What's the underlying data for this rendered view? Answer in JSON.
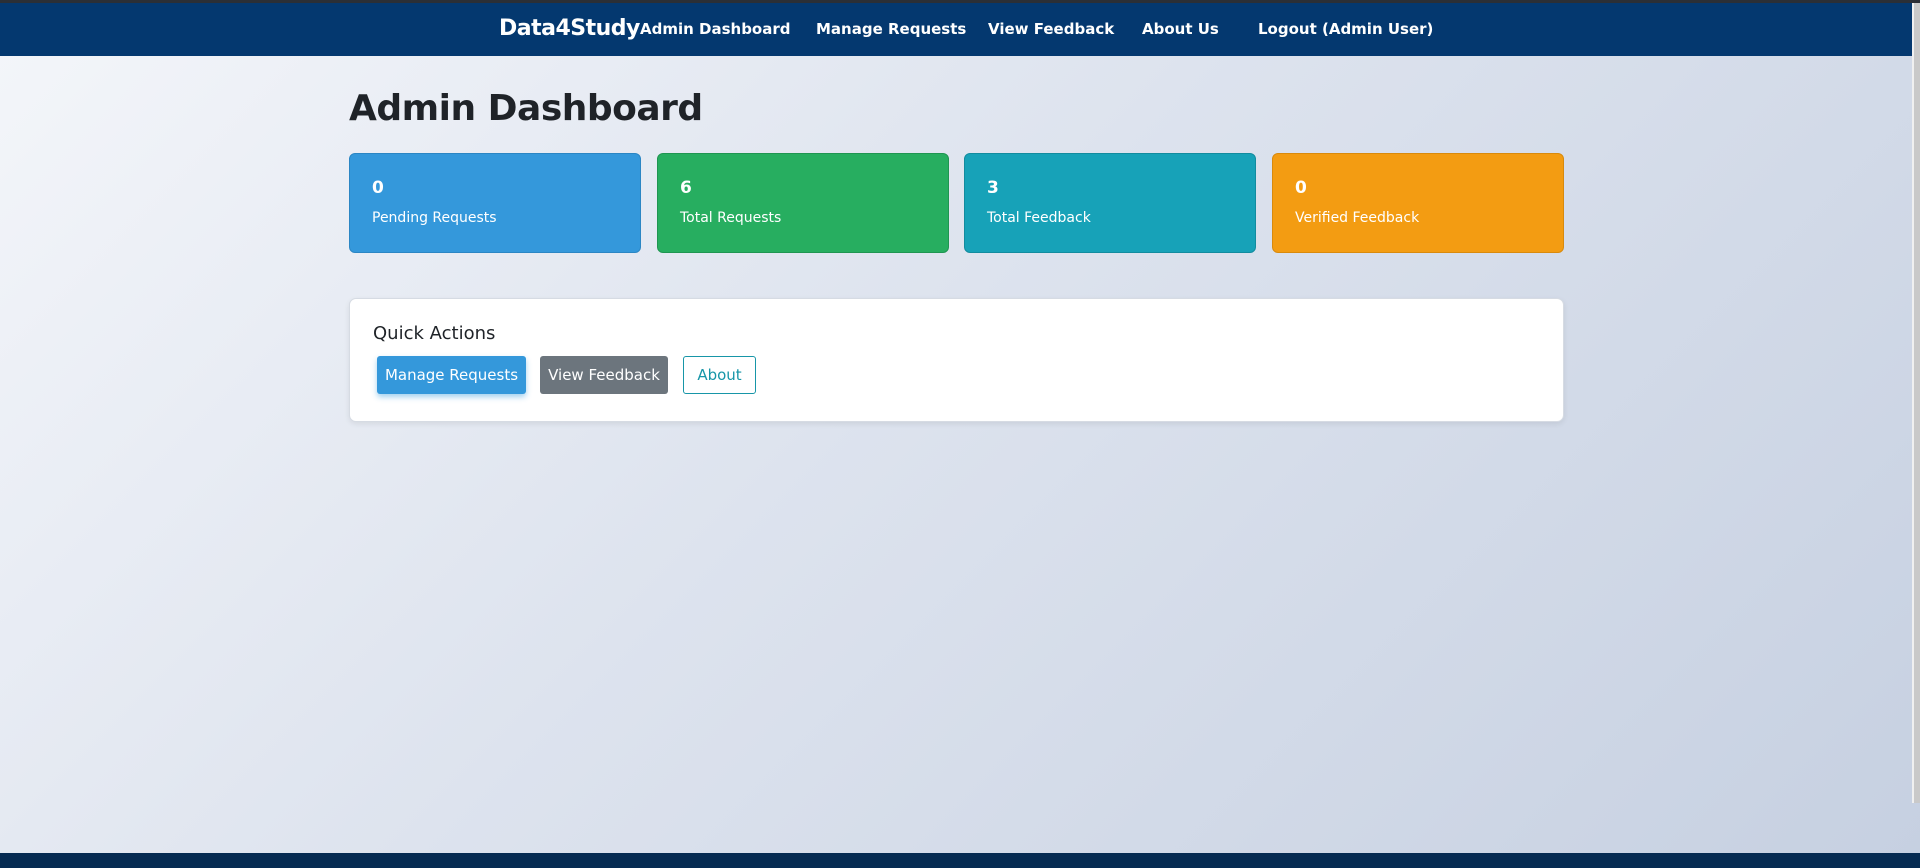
{
  "navbar": {
    "brand": "Data4Study",
    "links": [
      {
        "label": "Admin Dashboard"
      },
      {
        "label": "Manage Requests"
      },
      {
        "label": "View Feedback"
      },
      {
        "label": "About Us"
      },
      {
        "label": "Logout (Admin User)"
      }
    ],
    "background_color": "#04386f"
  },
  "main": {
    "title": "Admin Dashboard",
    "stats": [
      {
        "value": "0",
        "label": "Pending Requests",
        "color": "#3498db"
      },
      {
        "value": "6",
        "label": "Total Requests",
        "color": "#27ae60"
      },
      {
        "value": "3",
        "label": "Total Feedback",
        "color": "#17a2b8"
      },
      {
        "value": "0",
        "label": "Verified Feedback",
        "color": "#f39c12"
      }
    ],
    "quick_actions": {
      "title": "Quick Actions",
      "buttons": [
        {
          "label": "Manage Requests",
          "style": "primary"
        },
        {
          "label": "View Feedback",
          "style": "secondary"
        },
        {
          "label": "About",
          "style": "outline-info"
        }
      ]
    }
  }
}
